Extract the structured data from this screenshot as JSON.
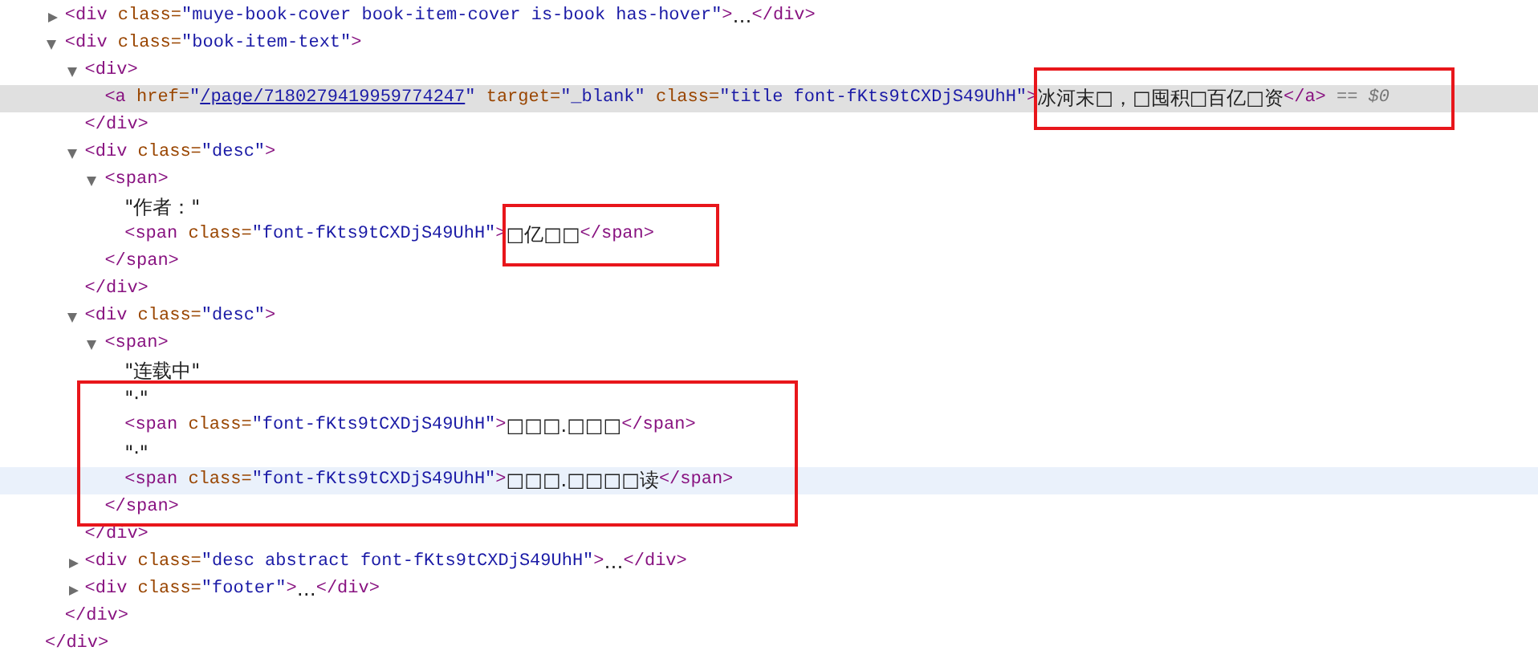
{
  "elements_tree": {
    "children": [
      {
        "open": [
          {
            "kind": "t",
            "text": "<div"
          },
          {
            "kind": "a",
            "text": " class="
          },
          {
            "kind": "v",
            "text": "\"muye-book-cover book-item-cover is-book has-hover\""
          },
          {
            "kind": "t",
            "text": ">"
          },
          {
            "kind": "s",
            "text": "…"
          },
          {
            "kind": "t",
            "text": "</div>"
          }
        ],
        "expanded": false,
        "selected": false,
        "hovered": false
      },
      {
        "open": [
          {
            "kind": "t",
            "text": "<div"
          },
          {
            "kind": "a",
            "text": " class="
          },
          {
            "kind": "v",
            "text": "\"book-item-text\""
          },
          {
            "kind": "t",
            "text": ">"
          }
        ],
        "expanded": true,
        "selected": false,
        "hovered": false,
        "children": [
          {
            "open": [
              {
                "kind": "t",
                "text": "<div>"
              }
            ],
            "expanded": true,
            "selected": false,
            "hovered": false,
            "children": [
              {
                "open": [
                  {
                    "kind": "t",
                    "text": "<a"
                  },
                  {
                    "kind": "a",
                    "text": " href="
                  },
                  {
                    "kind": "v",
                    "text": "\""
                  },
                  {
                    "kind": "l",
                    "text": "/page/7180279419959774247"
                  },
                  {
                    "kind": "v",
                    "text": "\""
                  },
                  {
                    "kind": "a",
                    "text": " target="
                  },
                  {
                    "kind": "v",
                    "text": "\"_blank\""
                  },
                  {
                    "kind": "a",
                    "text": " class="
                  },
                  {
                    "kind": "v",
                    "text": "\"title font-fKts9tCXDjS49UhH\""
                  },
                  {
                    "kind": "t",
                    "text": ">"
                  },
                  {
                    "kind": "s",
                    "text": "冰河末□，□囤积□百亿□资",
                    "box_start": true
                  },
                  {
                    "kind": "t",
                    "text": "</a>",
                    "box_end": true
                  },
                  {
                    "kind": "d",
                    "text": " == $0"
                  }
                ],
                "selected": true,
                "hovered": false
              }
            ],
            "close": [
              {
                "kind": "t",
                "text": "</div>"
              }
            ]
          },
          {
            "open": [
              {
                "kind": "t",
                "text": "<div"
              },
              {
                "kind": "a",
                "text": " class="
              },
              {
                "kind": "v",
                "text": "\"desc\""
              },
              {
                "kind": "t",
                "text": ">"
              }
            ],
            "expanded": true,
            "selected": false,
            "hovered": false,
            "children": [
              {
                "open": [
                  {
                    "kind": "t",
                    "text": "<span>"
                  }
                ],
                "expanded": true,
                "selected": false,
                "hovered": false,
                "children": [
                  {
                    "open": [
                      {
                        "kind": "s",
                        "text": "\"作者：\""
                      }
                    ],
                    "selected": false,
                    "hovered": false
                  },
                  {
                    "open": [
                      {
                        "kind": "t",
                        "text": "<span"
                      },
                      {
                        "kind": "a",
                        "text": " class="
                      },
                      {
                        "kind": "v",
                        "text": "\"font-fKts9tCXDjS49UhH\""
                      },
                      {
                        "kind": "t",
                        "text": ">"
                      },
                      {
                        "kind": "s",
                        "text": "□亿□□",
                        "box_start": true
                      },
                      {
                        "kind": "t",
                        "text": "</span>",
                        "box_end": true
                      }
                    ],
                    "selected": false,
                    "hovered": false
                  }
                ],
                "close": [
                  {
                    "kind": "t",
                    "text": "</span>"
                  }
                ]
              }
            ],
            "close": [
              {
                "kind": "t",
                "text": "</div>"
              }
            ]
          },
          {
            "open": [
              {
                "kind": "t",
                "text": "<div"
              },
              {
                "kind": "a",
                "text": " class="
              },
              {
                "kind": "v",
                "text": "\"desc\""
              },
              {
                "kind": "t",
                "text": ">"
              }
            ],
            "expanded": true,
            "selected": false,
            "hovered": false,
            "children": [
              {
                "open": [
                  {
                    "kind": "t",
                    "text": "<span>"
                  }
                ],
                "expanded": true,
                "selected": false,
                "hovered": false,
                "children": [
                  {
                    "open": [
                      {
                        "kind": "s",
                        "text": "\"连载中\""
                      }
                    ],
                    "selected": false,
                    "hovered": false
                  },
                  {
                    "open": [
                      {
                        "kind": "s",
                        "text": "\"·\"",
                        "box_start": true
                      }
                    ],
                    "selected": false,
                    "hovered": false
                  },
                  {
                    "open": [
                      {
                        "kind": "t",
                        "text": "<span"
                      },
                      {
                        "kind": "a",
                        "text": " class="
                      },
                      {
                        "kind": "v",
                        "text": "\"font-fKts9tCXDjS49UhH\""
                      },
                      {
                        "kind": "t",
                        "text": ">"
                      },
                      {
                        "kind": "s",
                        "text": "□□□.□□□"
                      },
                      {
                        "kind": "t",
                        "text": "</span>"
                      }
                    ],
                    "selected": false,
                    "hovered": false
                  },
                  {
                    "open": [
                      {
                        "kind": "s",
                        "text": "\"·\""
                      }
                    ],
                    "selected": false,
                    "hovered": false
                  },
                  {
                    "open": [
                      {
                        "kind": "t",
                        "text": "<span"
                      },
                      {
                        "kind": "a",
                        "text": " class="
                      },
                      {
                        "kind": "v",
                        "text": "\"font-fKts9tCXDjS49UhH\""
                      },
                      {
                        "kind": "t",
                        "text": ">"
                      },
                      {
                        "kind": "s",
                        "text": "□□□.□□□□读"
                      },
                      {
                        "kind": "t",
                        "text": "</span>"
                      }
                    ],
                    "selected": false,
                    "hovered": true
                  }
                ],
                "close": [
                  {
                    "kind": "t",
                    "text": "</span>",
                    "box_end": true
                  }
                ]
              }
            ],
            "close": [
              {
                "kind": "t",
                "text": "</div>"
              }
            ]
          },
          {
            "open": [
              {
                "kind": "t",
                "text": "<div"
              },
              {
                "kind": "a",
                "text": " class="
              },
              {
                "kind": "v",
                "text": "\"desc abstract font-fKts9tCXDjS49UhH\""
              },
              {
                "kind": "t",
                "text": ">"
              },
              {
                "kind": "s",
                "text": "…"
              },
              {
                "kind": "t",
                "text": "</div>"
              }
            ],
            "expanded": false,
            "selected": false,
            "hovered": false
          },
          {
            "open": [
              {
                "kind": "t",
                "text": "<div"
              },
              {
                "kind": "a",
                "text": " class="
              },
              {
                "kind": "v",
                "text": "\"footer\""
              },
              {
                "kind": "t",
                "text": ">"
              },
              {
                "kind": "s",
                "text": "…"
              },
              {
                "kind": "t",
                "text": "</div>"
              }
            ],
            "expanded": false,
            "selected": false,
            "hovered": false
          }
        ],
        "close": [
          {
            "kind": "t",
            "text": "</div>"
          }
        ]
      }
    ],
    "close": [
      {
        "kind": "t",
        "text": "</div>"
      }
    ]
  }
}
